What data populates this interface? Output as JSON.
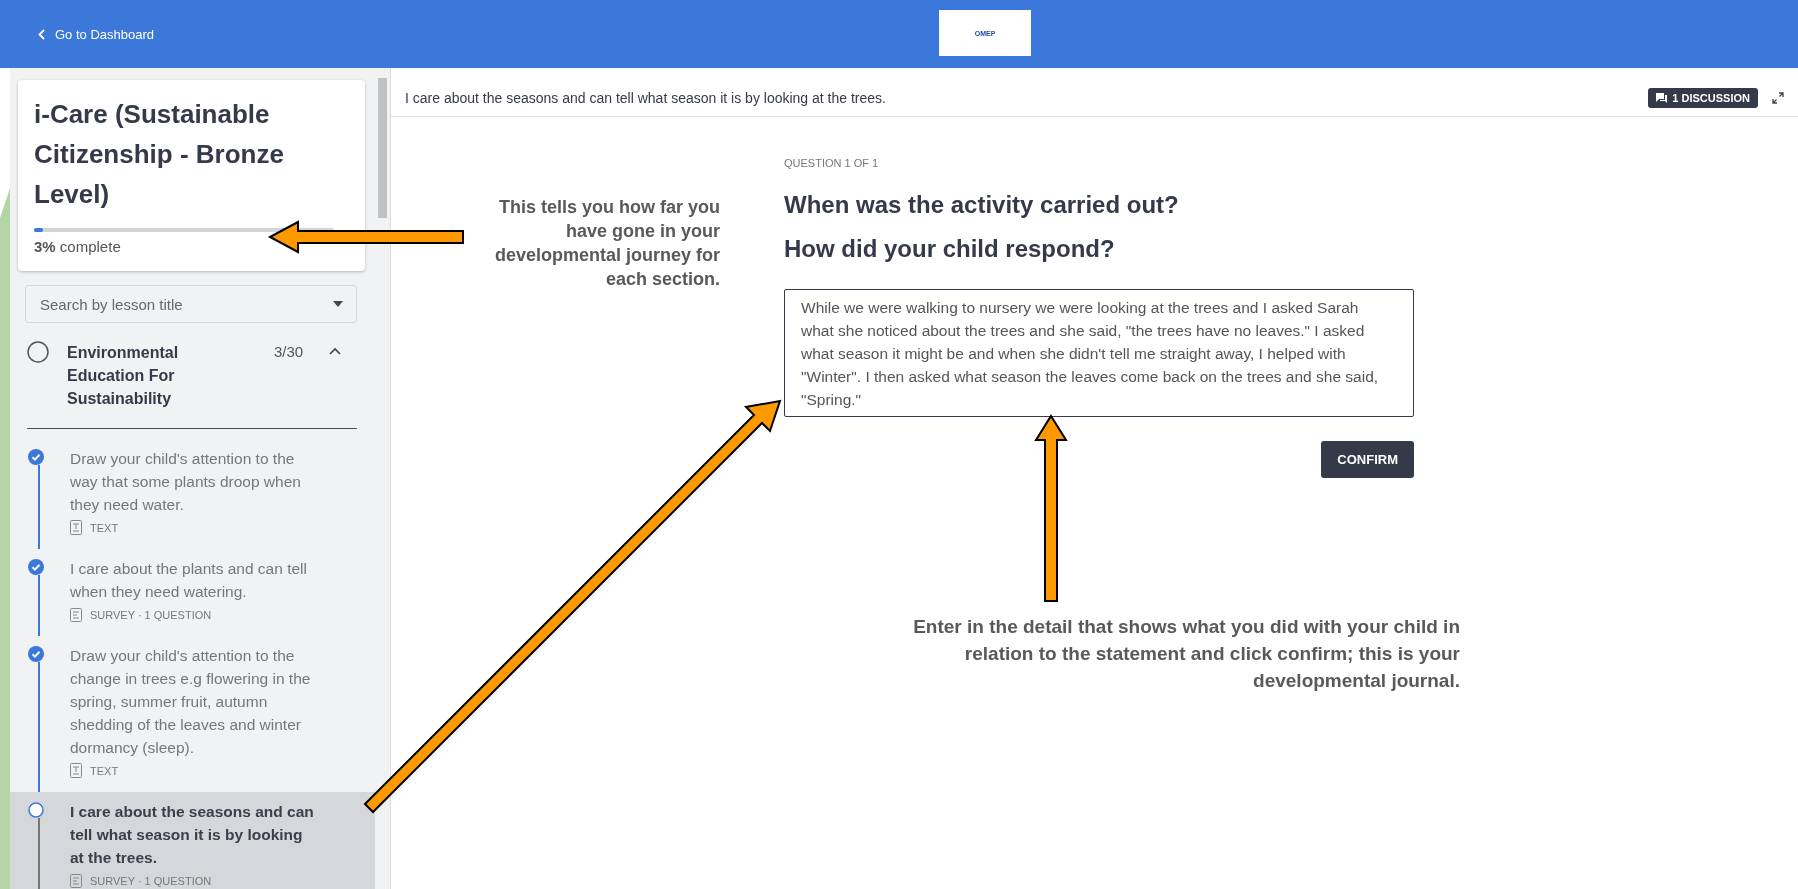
{
  "top_bar": {
    "back_link": "Go to Dashboard",
    "logo_text": "OMEP"
  },
  "sidebar": {
    "course": {
      "title": "i-Care (Sustainable Citizenship - Bronze Level)",
      "level": 0.03,
      "progress_text": "**3%** complete"
    },
    "search": {
      "placeholder": "Search by lesson title"
    },
    "section": {
      "title": "Environmental Education For Sustainability",
      "count": "3/30",
      "expanded": true
    },
    "lessons": [
      {
        "title": "Draw your child's attention to the way that some plants droop when they need water.",
        "type": "TEXT",
        "kind": "text",
        "completed": true,
        "selected": false
      },
      {
        "title": "I care about the plants and can tell when they need watering.",
        "type": "SURVEY · 1 QUESTION",
        "kind": "survey",
        "completed": true,
        "selected": false
      },
      {
        "title": "Draw your child's attention to the change in trees e.g flowering in the spring, summer fruit, autumn shedding of the leaves and winter dormancy (sleep).",
        "type": "TEXT",
        "kind": "text",
        "completed": true,
        "selected": false
      },
      {
        "title": "I care about the seasons and can tell what season it is by looking at the trees.",
        "type": "SURVEY · 1 QUESTION",
        "kind": "survey",
        "completed": false,
        "selected": true
      }
    ]
  },
  "main": {
    "lesson_title": "I care about the seasons and can tell what season it is by looking at the trees.",
    "discussion_button": "1 DISCUSSION",
    "question_counter": "QUESTION 1 OF 1",
    "question_lines": [
      "When was the activity carried out?",
      "How did your child respond?"
    ],
    "answer": "While we were walking to nursery we were looking at the trees and I asked Sarah what she noticed about the trees and she said, \"the trees have no leaves.\" I asked what season it might be and when she didn't tell me straight away, I helped with \"Winter\". I then asked what season the leaves come back on the trees and she said, \"Spring.\"",
    "confirm_button": "CONFIRM"
  },
  "callouts": [
    {
      "text": "This tells you how far you have gone in your developmental journey for each section."
    },
    {
      "text": "Enter in the detail that shows what you did with your child in relation to the statement and click confirm; this is your developmental journal."
    }
  ]
}
